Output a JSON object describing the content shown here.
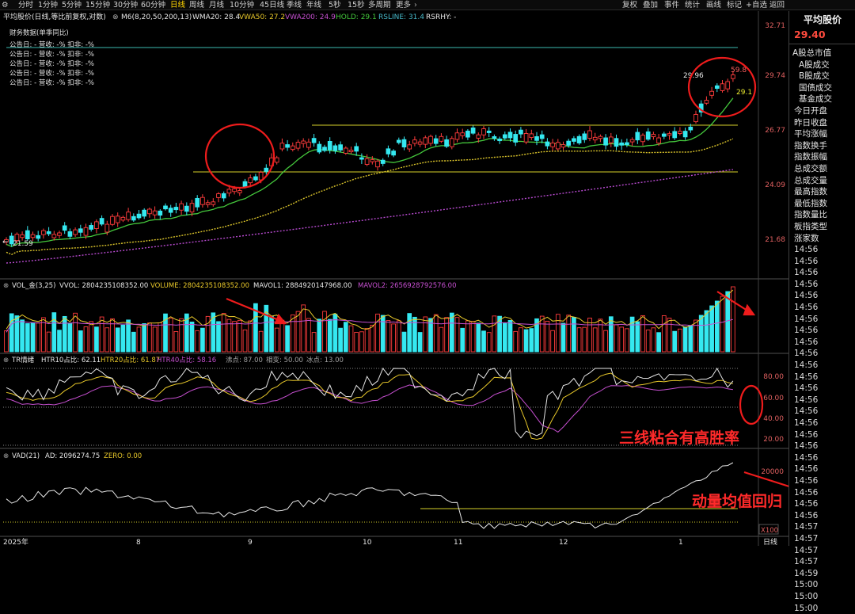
{
  "toolbar": {
    "periods": [
      "分时",
      "1分钟",
      "5分钟",
      "15分钟",
      "30分钟",
      "60分钟",
      "日线",
      "周线",
      "月线",
      "10分钟",
      "45日线",
      "季线",
      "年线",
      "5秒",
      "15秒",
      "多周期",
      "更多"
    ],
    "active_period": "日线",
    "actions": [
      "复权",
      "叠加",
      "事件",
      "统计",
      "画线",
      "标记",
      "+自选",
      "返回"
    ]
  },
  "main": {
    "header_name": "平均股价(日线,等比前复权,对数)",
    "indicators": [
      {
        "text": "M6(8,20,50,200,13)",
        "color": "#e6e6e6"
      },
      {
        "text": "WMA20: 28.4",
        "color": "#e6e6e6"
      },
      {
        "text": "VWA50: 27.2",
        "color": "#e8c82a"
      },
      {
        "text": "VWA200: 24.9",
        "color": "#c64fd0"
      },
      {
        "text": "HOLD: 29.1",
        "color": "#44c83c"
      },
      {
        "text": "RSLINE: 31.4",
        "color": "#46b8c8"
      },
      {
        "text": "RSRHY: -",
        "color": "#e6e6e6"
      }
    ],
    "fin_title": "财务数据(单季同比)",
    "fin_rows": [
      "公告日: -  营收: -%  扣非: -%",
      "公告日: -  营收: -%  扣非: -%",
      "公告日: -  营收: -%  扣非: -%",
      "公告日: -  营收: -%  扣非: -%",
      "公告日: -  营收: -%  扣非: -%"
    ],
    "y_ticks": [
      "32.71",
      "29.74",
      "26.77",
      "24.09",
      "21.68"
    ],
    "low_label": "21.59",
    "high_label": "29.96",
    "box_labels": [
      "59.8",
      "29.1"
    ]
  },
  "vol": {
    "name": "VOL_金(3,25)",
    "items": [
      {
        "text": "VVOL: 2804235108352.00",
        "color": "#e6e6e6"
      },
      {
        "text": "VOLUME: 2804235108352.00",
        "color": "#e8c82a"
      },
      {
        "text": "MAVOL1: 2884920147968.00",
        "color": "#e6e6e6"
      },
      {
        "text": "MAVOL2: 2656928792576.00",
        "color": "#c64fd0"
      }
    ]
  },
  "tr": {
    "name": "TR情绪",
    "items": [
      {
        "text": "HTR10占比: 62.11",
        "color": "#e6e6e6"
      },
      {
        "text": "HTR20占比: 61.87",
        "color": "#e8c82a"
      },
      {
        "text": "HTR40占比: 58.16",
        "color": "#c64fd0"
      },
      {
        "text": "沸点: 87.00",
        "color": "#a0a0a0"
      },
      {
        "text": "相变: 50.00",
        "color": "#a0a0a0"
      },
      {
        "text": "冰点: 13.00",
        "color": "#a0a0a0"
      }
    ],
    "y_ticks": [
      "80.00",
      "60.00",
      "40.00",
      "20.00"
    ]
  },
  "vad": {
    "name": "VAD(21)",
    "items": [
      {
        "text": "AD: 2096274.75",
        "color": "#e6e6e6"
      },
      {
        "text": "ZERO: 0.00",
        "color": "#e8c82a"
      }
    ],
    "y_ticks": [
      "20000"
    ],
    "unit": "X100"
  },
  "x_axis": {
    "labels": [
      "2025年",
      "8",
      "9",
      "10",
      "11",
      "12",
      "1"
    ],
    "right_label": "日线"
  },
  "annotations": {
    "tr_note": "三线粘合有高胜率",
    "vad_note": "动量均值回归"
  },
  "side_panel": {
    "title": "平均股价",
    "price": "29.40",
    "header_label": "A股总市值",
    "fields": [
      "A股成交",
      "B股成交",
      "国债成交",
      "基金成交",
      "今日开盘",
      "昨日收盘",
      "平均涨幅",
      "指数换手",
      "指数振幅",
      "总成交额",
      "总成交量",
      "最高指数",
      "最低指数",
      "指数量比",
      "板指类型",
      "涨家数"
    ],
    "times": [
      "14:56",
      "14:56",
      "14:56",
      "14:56",
      "14:56",
      "14:56",
      "14:56",
      "14:56",
      "14:56",
      "14:56",
      "14:56",
      "14:56",
      "14:56",
      "14:56",
      "14:56",
      "14:56",
      "14:56",
      "14:56",
      "14:56",
      "14:56",
      "14:56",
      "14:56",
      "14:56",
      "14:56",
      "14:57",
      "14:57",
      "14:57",
      "14:57",
      "14:59",
      "15:00",
      "15:00",
      "15:00"
    ]
  },
  "colors": {
    "up": "#ff3c3c",
    "down": "#35e8f0",
    "accent": "#ffd400",
    "annotation": "#ff2a2a"
  }
}
